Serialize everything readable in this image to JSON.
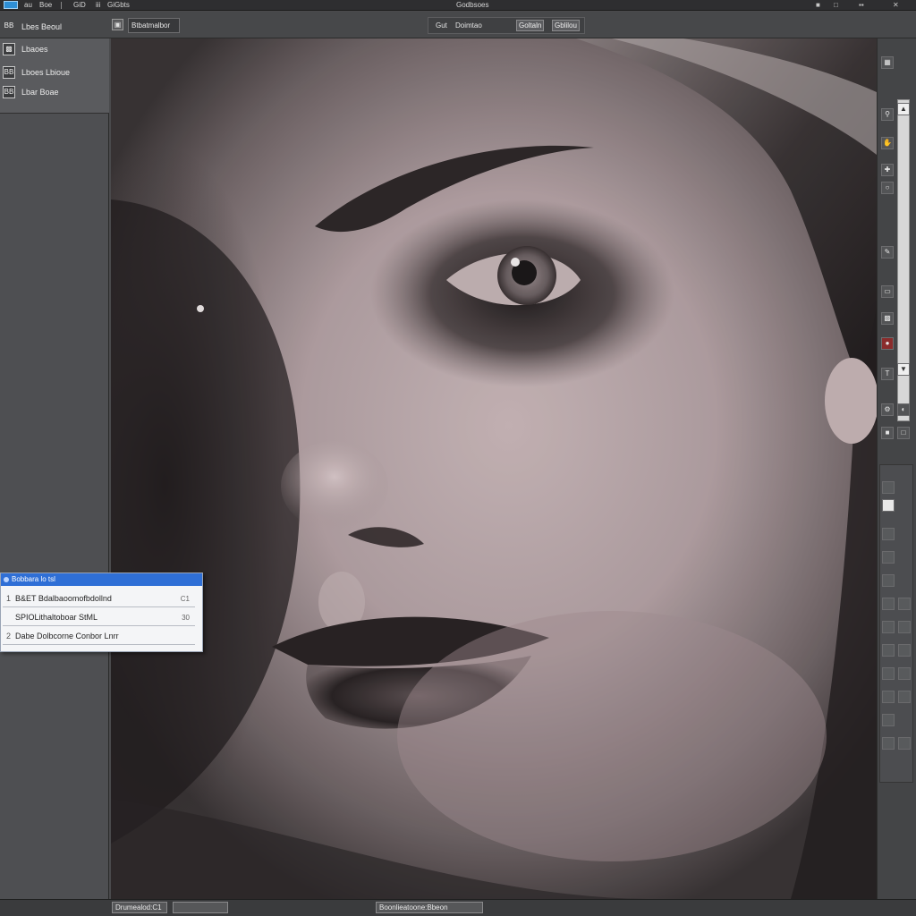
{
  "menubar": {
    "items": [
      "au",
      "Boe",
      "GiD",
      "iii",
      "GiGbts"
    ],
    "title": "Godbsoes"
  },
  "options_bar": {
    "tool_field": "Btbatmalbor",
    "group_label": "Gut",
    "group_text": "Doimtao",
    "btn1": "Goltaln",
    "btn2": "Gblilou"
  },
  "left_panel": {
    "rows": [
      {
        "icon": "BB",
        "label": "Lbes Beoul"
      },
      {
        "icon": "",
        "label": "Lbaoes"
      },
      {
        "icon": "BB",
        "label": "Lboes Lbioue"
      },
      {
        "icon": "BB",
        "label": "Lbar Boae"
      }
    ]
  },
  "popup": {
    "title": "Bobbara lo tsl",
    "rows": [
      {
        "num": "1",
        "text": "B&ET Bdalbaoomofbdollnd",
        "kbd": "C1"
      },
      {
        "num": "",
        "text": "SPIOLithaltoboar StML",
        "kbd": "30"
      },
      {
        "num": "2",
        "text": "Dabe Dolbcorne Conbor Lnrr",
        "kbd": ""
      }
    ]
  },
  "statusbar": {
    "box1": "Drumealod:C1",
    "box2": "",
    "box3": "Boonlieatoone:Bbeon"
  },
  "colors": {
    "accent": "#2f6fd6",
    "panel": "#4e4f52",
    "toolbar": "#47484a"
  },
  "icons": [
    "app-logo-icon",
    "layers-icon",
    "channels-icon",
    "paths-icon",
    "zoom-icon",
    "hand-icon",
    "brush-icon",
    "eraser-icon"
  ]
}
